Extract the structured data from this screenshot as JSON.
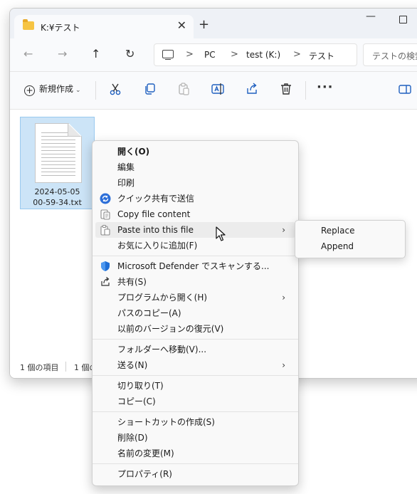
{
  "window": {
    "tab_title": "K:¥テスト",
    "tab_close": "✕",
    "new_tab": "+",
    "minimize": "—"
  },
  "nav": {
    "back": "←",
    "forward": "→",
    "up": "↑",
    "refresh": "↻",
    "breadcrumb": [
      "PC",
      "test (K:)",
      "テスト"
    ],
    "separator": ">",
    "search_placeholder": "テストの検索"
  },
  "toolbar": {
    "new_label": "新規作成",
    "new_caret": "⌄",
    "more": "···",
    "icons": [
      "cut-icon",
      "copy-icon",
      "paste-icon",
      "rename-icon",
      "share-icon",
      "delete-icon",
      "details-pane-icon"
    ]
  },
  "file": {
    "name_line1": "2024-05-05",
    "name_line2": "00-59-34.txt",
    "selected": true
  },
  "status": {
    "items": "1 個の項目",
    "selected": "1 個の"
  },
  "context_menu": {
    "items": [
      {
        "label": "開く(O)",
        "bold": true
      },
      {
        "label": "編集"
      },
      {
        "label": "印刷"
      },
      {
        "label": "クイック共有で送信",
        "icon": "quick-share-icon"
      },
      {
        "label": "Copy file content",
        "icon": "copy-file-content-icon"
      },
      {
        "label": "Paste into this file",
        "icon": "paste-into-file-icon",
        "submenu": true,
        "hovered": true
      },
      {
        "label": "お気に入りに追加(F)"
      },
      {
        "label": "Microsoft Defender でスキャンする...",
        "icon": "defender-shield-icon"
      },
      {
        "label": "共有(S)",
        "icon": "share-icon"
      },
      {
        "label": "プログラムから開く(H)",
        "submenu": true
      },
      {
        "label": "パスのコピー(A)"
      },
      {
        "label": "以前のバージョンの復元(V)"
      },
      {
        "label": "フォルダーへ移動(V)..."
      },
      {
        "label": "送る(N)",
        "submenu": true
      },
      {
        "label": "切り取り(T)"
      },
      {
        "label": "コピー(C)"
      },
      {
        "label": "ショートカットの作成(S)"
      },
      {
        "label": "削除(D)"
      },
      {
        "label": "名前の変更(M)"
      },
      {
        "label": "プロパティ(R)"
      }
    ],
    "submenu_arrow": "›"
  },
  "submenu": {
    "items": [
      "Replace",
      "Append"
    ]
  },
  "colors": {
    "selection_fill": "#cce4f7",
    "selection_border": "#99c9ef",
    "menu_bg": "#f9f9f9",
    "hover_bg": "#ececec",
    "defender_blue": "#1f6fd6"
  }
}
